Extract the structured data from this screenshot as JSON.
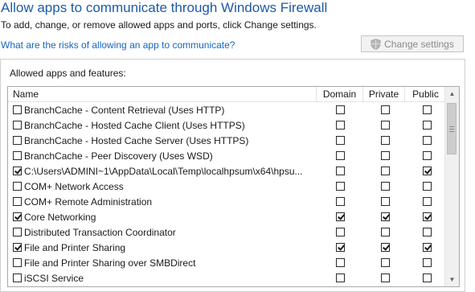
{
  "page": {
    "title": "Allow apps to communicate through Windows Firewall",
    "subtitle": "To add, change, or remove allowed apps and ports, click Change settings.",
    "risk_link": "What are the risks of allowing an app to communicate?",
    "change_settings_label": "Change settings"
  },
  "group": {
    "label": "Allowed apps and features:",
    "columns": {
      "name": "Name",
      "domain": "Domain",
      "private": "Private",
      "public": "Public"
    },
    "rows": [
      {
        "name": "BranchCache - Content Retrieval (Uses HTTP)",
        "enabled": false,
        "domain": false,
        "private": false,
        "public": false
      },
      {
        "name": "BranchCache - Hosted Cache Client (Uses HTTPS)",
        "enabled": false,
        "domain": false,
        "private": false,
        "public": false
      },
      {
        "name": "BranchCache - Hosted Cache Server (Uses HTTPS)",
        "enabled": false,
        "domain": false,
        "private": false,
        "public": false
      },
      {
        "name": "BranchCache - Peer Discovery (Uses WSD)",
        "enabled": false,
        "domain": false,
        "private": false,
        "public": false
      },
      {
        "name": "C:\\Users\\ADMINI~1\\AppData\\Local\\Temp\\localhpsum\\x64\\hpsu...",
        "enabled": true,
        "domain": false,
        "private": false,
        "public": true
      },
      {
        "name": "COM+ Network Access",
        "enabled": false,
        "domain": false,
        "private": false,
        "public": false
      },
      {
        "name": "COM+ Remote Administration",
        "enabled": false,
        "domain": false,
        "private": false,
        "public": false
      },
      {
        "name": "Core Networking",
        "enabled": true,
        "domain": true,
        "private": true,
        "public": true
      },
      {
        "name": "Distributed Transaction Coordinator",
        "enabled": false,
        "domain": false,
        "private": false,
        "public": false
      },
      {
        "name": "File and Printer Sharing",
        "enabled": true,
        "domain": true,
        "private": true,
        "public": true
      },
      {
        "name": "File and Printer Sharing over SMBDirect",
        "enabled": false,
        "domain": false,
        "private": false,
        "public": false
      },
      {
        "name": "iSCSI Service",
        "enabled": false,
        "domain": false,
        "private": false,
        "public": false
      }
    ]
  },
  "icons": {
    "change_settings": "uac-shield-icon",
    "scroll_up": "chevron-up-icon",
    "scroll_down": "chevron-down-icon"
  },
  "colors": {
    "title": "#1e5aa8",
    "link": "#1565c0",
    "disabled_text": "#8a8a8a"
  }
}
